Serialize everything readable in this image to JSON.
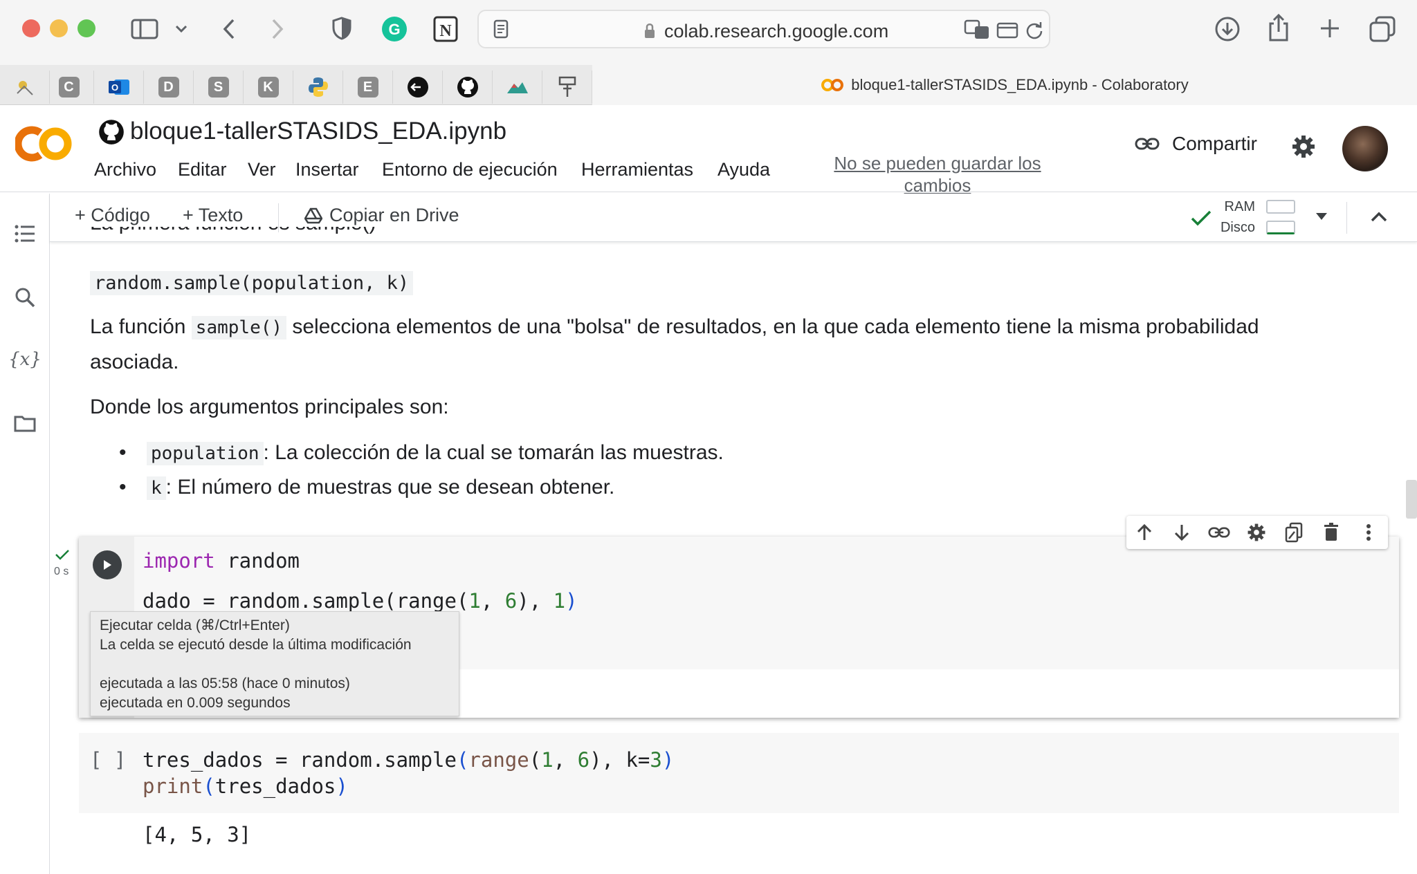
{
  "browser": {
    "url": "colab.research.google.com",
    "tab_title": "bloque1-tallerSTASIDS_EDA.ipynb - Colaboratory",
    "favorites": [
      "C",
      "D",
      "S",
      "K",
      "E"
    ]
  },
  "header": {
    "notebook_title": "bloque1-tallerSTASIDS_EDA.ipynb",
    "menu": [
      "Archivo",
      "Editar",
      "Ver",
      "Insertar",
      "Entorno de ejecución",
      "Herramientas",
      "Ayuda"
    ],
    "save_warning": "No se pueden guardar los cambios",
    "share_label": "Compartir"
  },
  "toolbar": {
    "code_label": "Código",
    "text_label": "Texto",
    "drive_label": "Copiar en Drive",
    "ram_label": "RAM",
    "disk_label": "Disco"
  },
  "markdown": {
    "partial_heading": "La primera función es sample()",
    "signature": "random.sample(population, k)",
    "desc_prefix": "La función",
    "desc_code": "sample()",
    "desc_line1_rest": "selecciona elementos de una \"bolsa\" de resultados, en la que cada elemento tiene la misma probabilidad",
    "desc_line2": "asociada.",
    "args_intro": "Donde los argumentos principales son:",
    "args": [
      {
        "code": "population",
        "text": ": La colección de la cual se tomarán las muestras."
      },
      {
        "code": "k",
        "text": ": El número de muestras que se desean obtener."
      }
    ]
  },
  "cell1": {
    "exec_time": "0 s",
    "line1_kw": "import",
    "line1_rest": " random",
    "line2_hidden": "dado = random.sample(range(",
    "line2_visible_a": "1",
    "line2_visible_b": ", ",
    "line2_visible_c": "6",
    "line2_visible_d": "), ",
    "line2_visible_e": "1",
    "line2_visible_f": ")"
  },
  "tooltip": {
    "line1": "Ejecutar celda (⌘/Ctrl+Enter)",
    "line2": "La celda se ejecutó desde la última modificación",
    "line3": "ejecutada a las 05:58 (hace 0 minutos)",
    "line4": "ejecutada en 0.009 segundos"
  },
  "cell2": {
    "bracket": "[ ]",
    "code_a": "tres_dados = random.sample",
    "code_b": "(",
    "code_c": "range",
    "code_d": "(",
    "code_e": "1",
    "code_f": ", ",
    "code_g": "6",
    "code_h": "), k=",
    "code_i": "3",
    "code_j": ")",
    "line2_fn": "print",
    "line2_open": "(",
    "line2_arg": "tres_dados",
    "line2_close": ")",
    "output": "[4, 5, 3]"
  },
  "colors": {
    "accent_orange": "#f9ab00",
    "keyword": "#9c27b0",
    "number": "#2e7d32",
    "check_green": "#188038"
  }
}
